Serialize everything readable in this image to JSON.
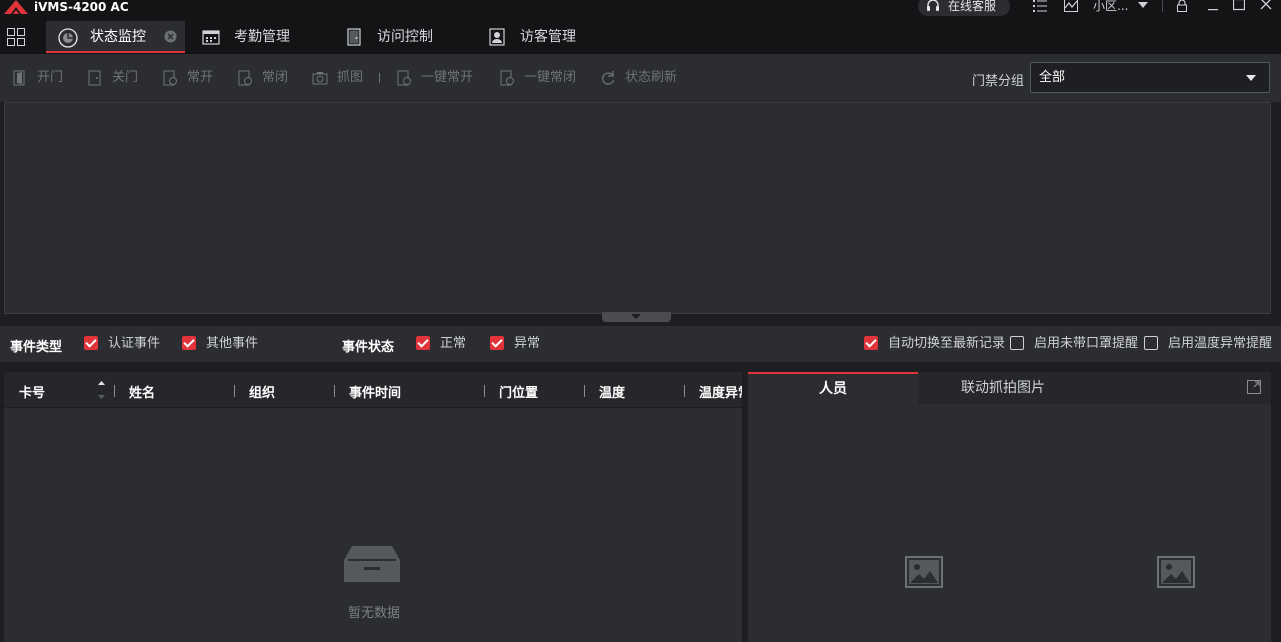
{
  "app": {
    "title": "iVMS-4200 AC"
  },
  "titlebar": {
    "support_label": "在线客服",
    "user_name": "小区..."
  },
  "tabs": {
    "status": "状态监控",
    "attendance": "考勤管理",
    "access": "访问控制",
    "visitor": "访客管理"
  },
  "toolbar": {
    "open_door": "开门",
    "close_door": "关门",
    "remain_open": "常开",
    "remain_closed": "常闭",
    "capture": "抓图",
    "one_key_open": "一键常开",
    "one_key_closed": "一键常闭",
    "refresh": "状态刷新",
    "group_label": "门禁分组",
    "group_value": "全部"
  },
  "filters": {
    "event_type_label": "事件类型",
    "auth_event": "认证事件",
    "other_event": "其他事件",
    "event_status_label": "事件状态",
    "normal": "正常",
    "abnormal": "异常",
    "auto_switch": "自动切换至最新记录",
    "mask_alert": "启用未带口罩提醒",
    "temp_alert": "启用温度异常提醒",
    "checked": {
      "auth_event": true,
      "other_event": true,
      "normal": true,
      "abnormal": true,
      "auto_switch": true,
      "mask_alert": false,
      "temp_alert": false
    }
  },
  "events_table": {
    "columns": [
      "卡号",
      "姓名",
      "组织",
      "事件时间",
      "门位置",
      "温度",
      "温度异常"
    ],
    "rows": [],
    "empty_text": "暂无数据"
  },
  "detail": {
    "tabs": [
      "人员",
      "联动抓拍图片"
    ]
  },
  "colors": {
    "accent": "#e0343a",
    "background": "#1d1e21",
    "panel": "#2b2d31"
  }
}
